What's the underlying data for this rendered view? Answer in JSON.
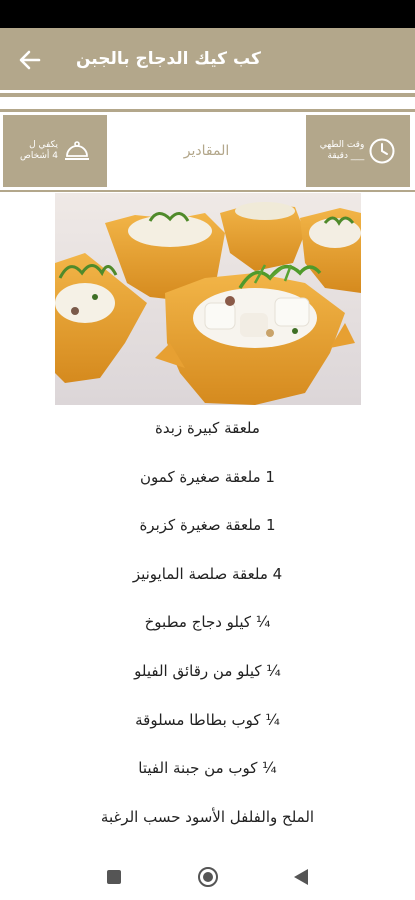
{
  "app_bar": {
    "title": "كب كيك الدجاج بالجبن",
    "back_icon": "arrow-left-icon"
  },
  "info": {
    "servings_line1": "يكفي ل",
    "servings_line2": "4 أشخاص",
    "servings_icon": "serving-dish-icon",
    "tab_label": "المقادير",
    "time_line1": "وقت الطهي",
    "time_line2": "___ دقيقة",
    "time_icon": "clock-icon"
  },
  "colors": {
    "accent": "#b3a78b",
    "status_bar": "#000000"
  },
  "ingredients": [
    "ملعقة كبيرة زبدة",
    "1 ملعقة صغيرة كمون",
    "1 ملعقة صغيرة كزبرة",
    "4 ملعقة صلصة المايونيز",
    "¼ كيلو دجاج مطبوخ",
    "¼ كيلو من رقائق الفيلو",
    "¼ كوب بطاطا مسلوقة",
    "¼ كوب من جبنة الفيتا",
    "الملح والفلفل الأسود حسب الرغبة"
  ],
  "nav": {
    "recents_icon": "square-recents-icon",
    "home_icon": "circle-home-icon",
    "back_icon": "triangle-back-icon"
  }
}
